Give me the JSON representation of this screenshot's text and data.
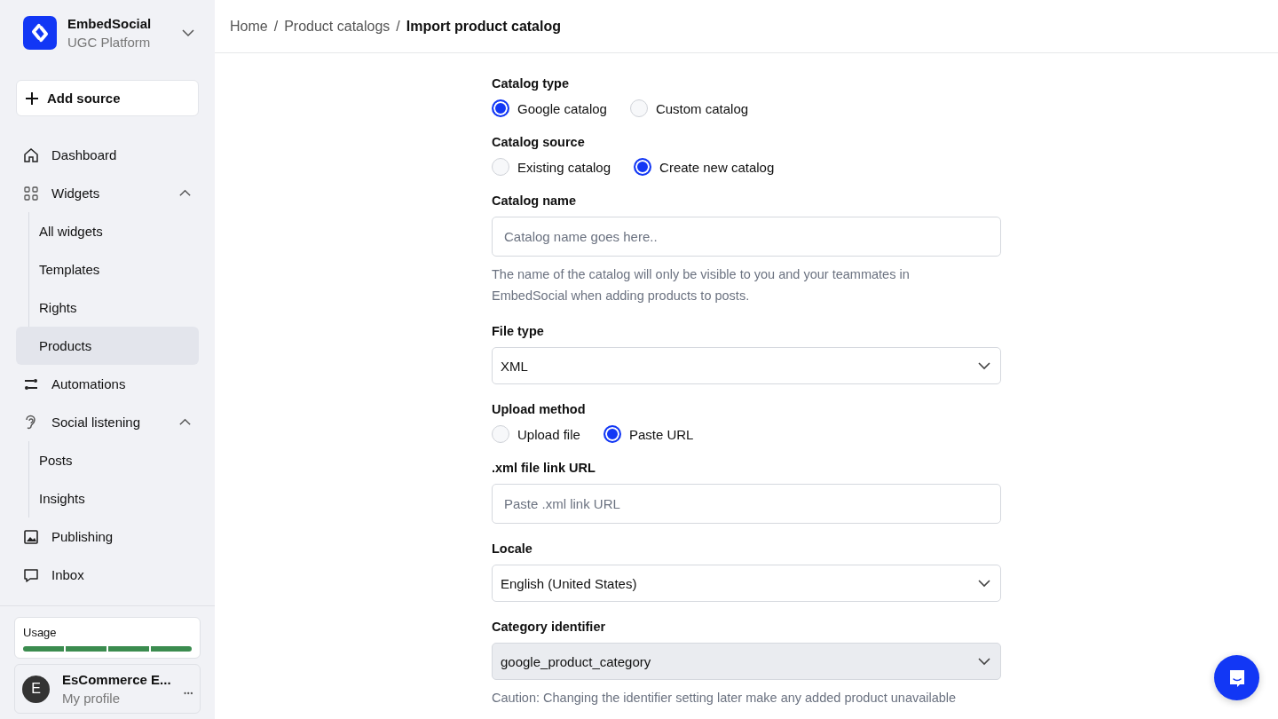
{
  "brand": {
    "name": "EmbedSocial",
    "subtitle": "UGC Platform"
  },
  "add_source": {
    "label": "Add source"
  },
  "nav": [
    {
      "label": "Dashboard",
      "selected": false
    },
    {
      "label": "Widgets",
      "selected": false,
      "expanded": true,
      "children": [
        {
          "label": "All widgets",
          "selected": false
        },
        {
          "label": "Templates",
          "selected": false
        },
        {
          "label": "Rights",
          "selected": false
        },
        {
          "label": "Products",
          "selected": true
        }
      ]
    },
    {
      "label": "Automations",
      "selected": false
    },
    {
      "label": "Social listening",
      "selected": false,
      "expanded": true,
      "children": [
        {
          "label": "Posts",
          "selected": false
        },
        {
          "label": "Insights",
          "selected": false
        }
      ]
    },
    {
      "label": "Publishing",
      "selected": false
    },
    {
      "label": "Inbox",
      "selected": false
    }
  ],
  "usage": {
    "label": "Usage",
    "level": 1
  },
  "profile": {
    "initial": "E",
    "name": "EsCommerce E...",
    "subtitle": "My profile"
  },
  "breadcrumb": [
    {
      "label": "Home",
      "separator": "/"
    },
    {
      "label": "Product catalogs",
      "separator": "/"
    },
    {
      "label": "Import product catalog"
    }
  ],
  "form": [
    {
      "kind": "radio",
      "label": "Catalog type",
      "options": [
        {
          "label": "Google catalog",
          "selected": true
        },
        {
          "label": "Custom catalog",
          "selected": false
        }
      ]
    },
    {
      "kind": "radio",
      "label": "Catalog source",
      "options": [
        {
          "label": "Existing catalog",
          "selected": false
        },
        {
          "label": "Create new catalog",
          "selected": true
        }
      ]
    },
    {
      "kind": "input",
      "label": "Catalog name",
      "placeholder": "Catalog name goes here..",
      "help": "The name of the catalog will only be visible to you and your teammates in EmbedSocial when adding products to posts."
    },
    {
      "kind": "select",
      "label": "File type",
      "value": "XML",
      "disabled": false
    },
    {
      "kind": "radio",
      "label": "Upload method",
      "options": [
        {
          "label": "Upload file",
          "selected": false
        },
        {
          "label": "Paste URL",
          "selected": true
        }
      ]
    },
    {
      "kind": "input",
      "label": ".xml file link URL",
      "placeholder": "Paste .xml link URL"
    },
    {
      "kind": "select",
      "label": "Locale",
      "value": "English (United States)",
      "disabled": false
    },
    {
      "kind": "select",
      "label": "Category identifier",
      "value": "google_product_category",
      "disabled": true,
      "help": "Caution: Changing the identifier setting later make any added product unavailable"
    }
  ]
}
